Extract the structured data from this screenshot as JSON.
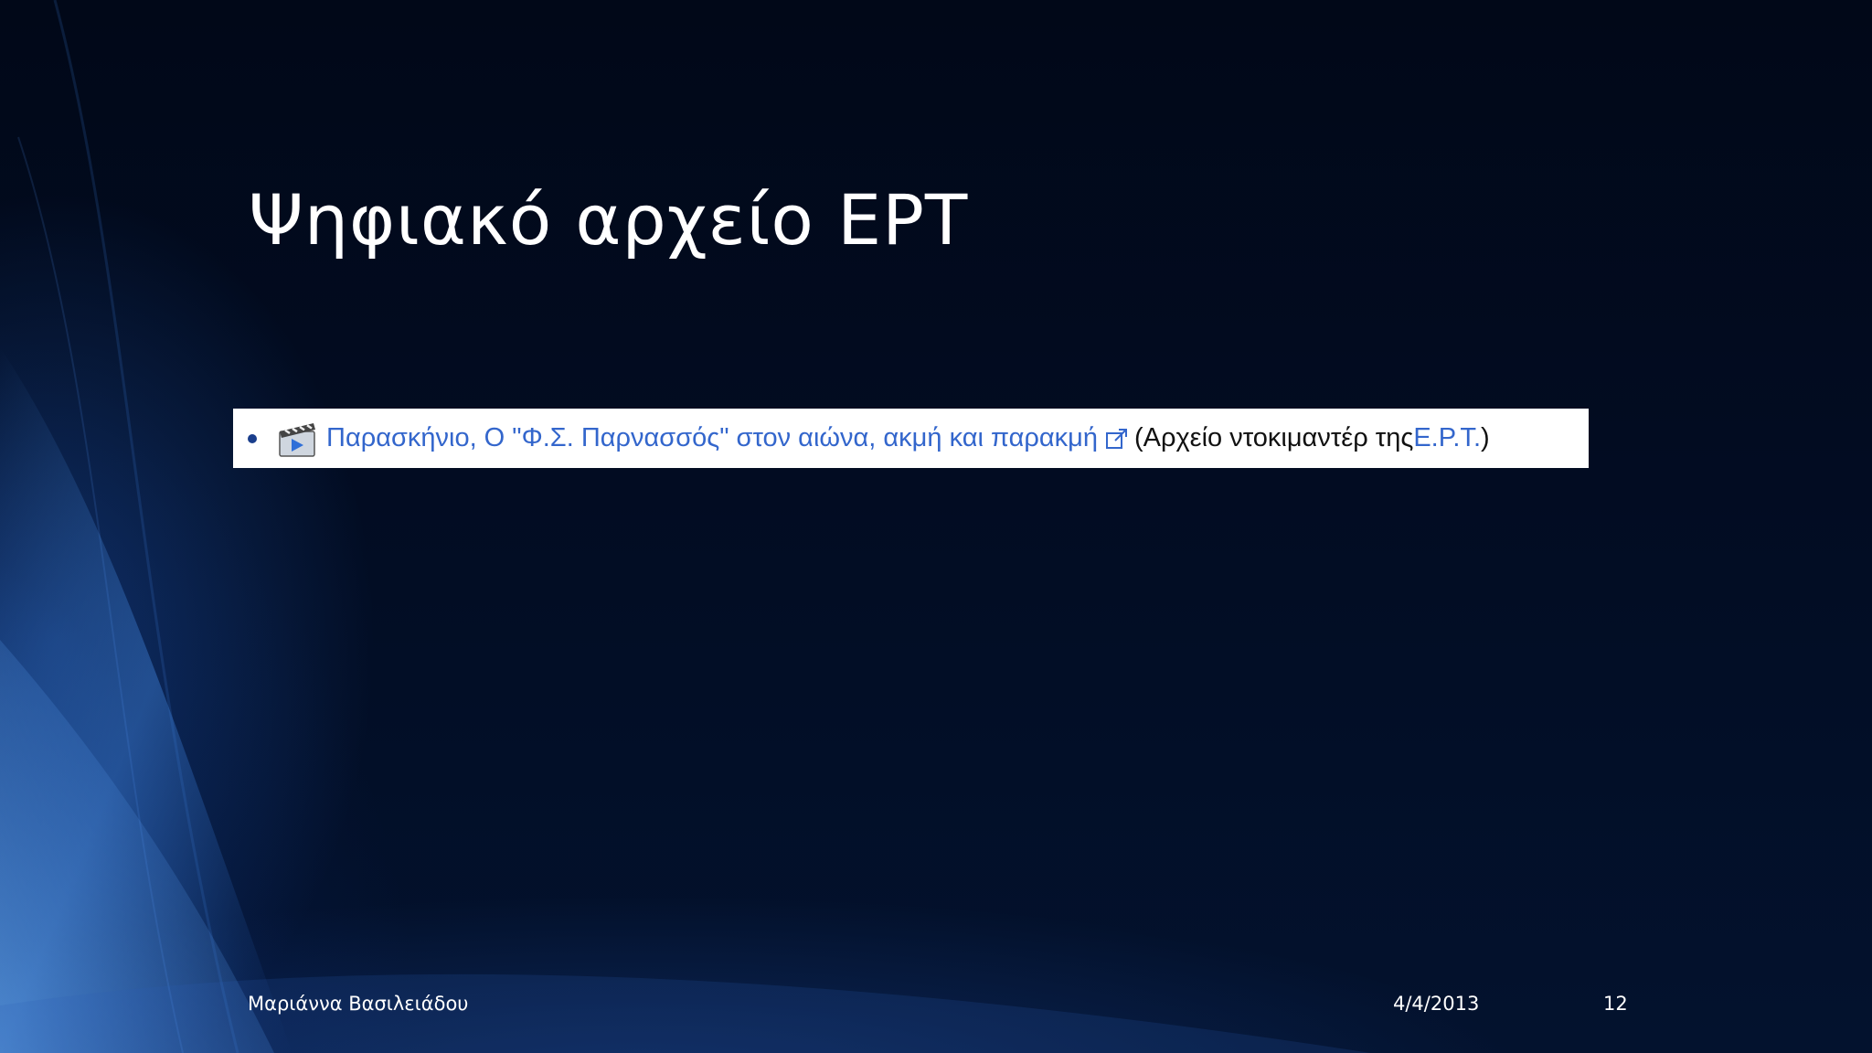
{
  "slide": {
    "title": "Ψηφιακό αρχείο ΕΡΤ",
    "embed": {
      "link_text": "Παρασκήνιο, Ο \"Φ.Σ. Παρνασσός\" στον αιώνα, ακμή και παρακμή",
      "note_open": "(Αρχείο ντοκιμαντέρ της ",
      "note_link": "Ε.Ρ.Τ.",
      "note_close": ")",
      "link_color": "#3366cc"
    },
    "footer": {
      "author": "Μαριάννα Βασιλειάδου",
      "date": "4/4/2013",
      "page_number": "12"
    }
  },
  "icons": [
    "video-clapper-icon",
    "external-link-icon",
    "bullet-dot"
  ]
}
